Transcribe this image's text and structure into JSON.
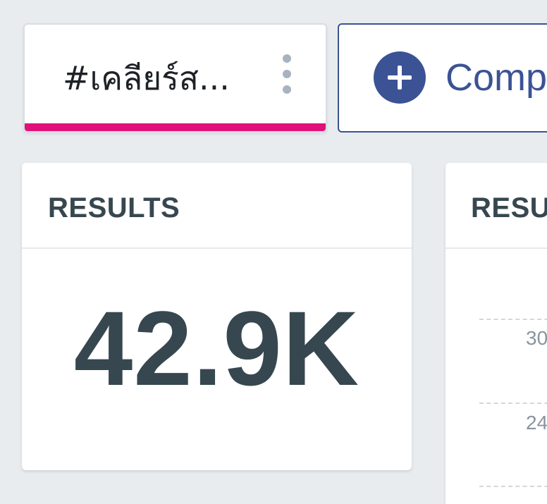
{
  "query_tab": {
    "label": "#เคลียร์ส...",
    "underline_color": "#e0117a",
    "menu_icon": "kebab-vertical-icon"
  },
  "compare_button": {
    "label": "Comp",
    "icon": "plus-circle-icon",
    "color": "#3b5394"
  },
  "cards": {
    "results_total": {
      "title": "RESULTS",
      "value": "42.9K"
    },
    "results_chart": {
      "title": "RESU",
      "ticks": [
        "30",
        "24"
      ]
    }
  }
}
